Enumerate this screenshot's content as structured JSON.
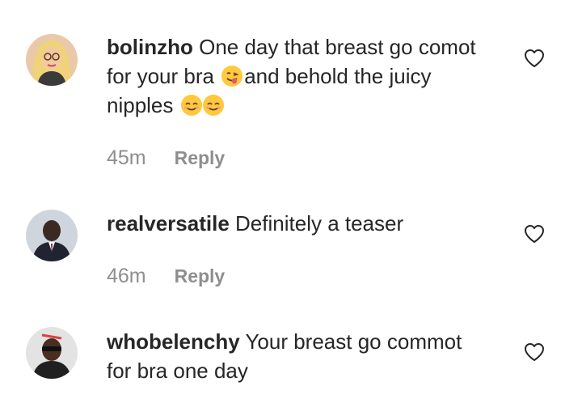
{
  "comments": [
    {
      "username": "bolinzho",
      "lines": [
        "One day that breast go comot",
        "for your bra",
        "and behold the juicy",
        "nipples"
      ],
      "emojis": [
        "face-savoring-food",
        "smiling-face-with-smiling-eyes",
        "smiling-face-with-smiling-eyes"
      ],
      "time": "45m",
      "reply_label": "Reply",
      "like_icon": "heart-outline-icon"
    },
    {
      "username": "realversatile",
      "lines": [
        "Definitely a teaser"
      ],
      "time": "46m",
      "reply_label": "Reply",
      "like_icon": "heart-outline-icon"
    },
    {
      "username": "whobelenchy",
      "lines": [
        "Your breast go commot",
        "for bra one day"
      ],
      "like_icon": "heart-outline-icon"
    }
  ],
  "colors": {
    "text": "#262626",
    "meta": "#8e8e8e",
    "emoji": "#ffc83d"
  }
}
